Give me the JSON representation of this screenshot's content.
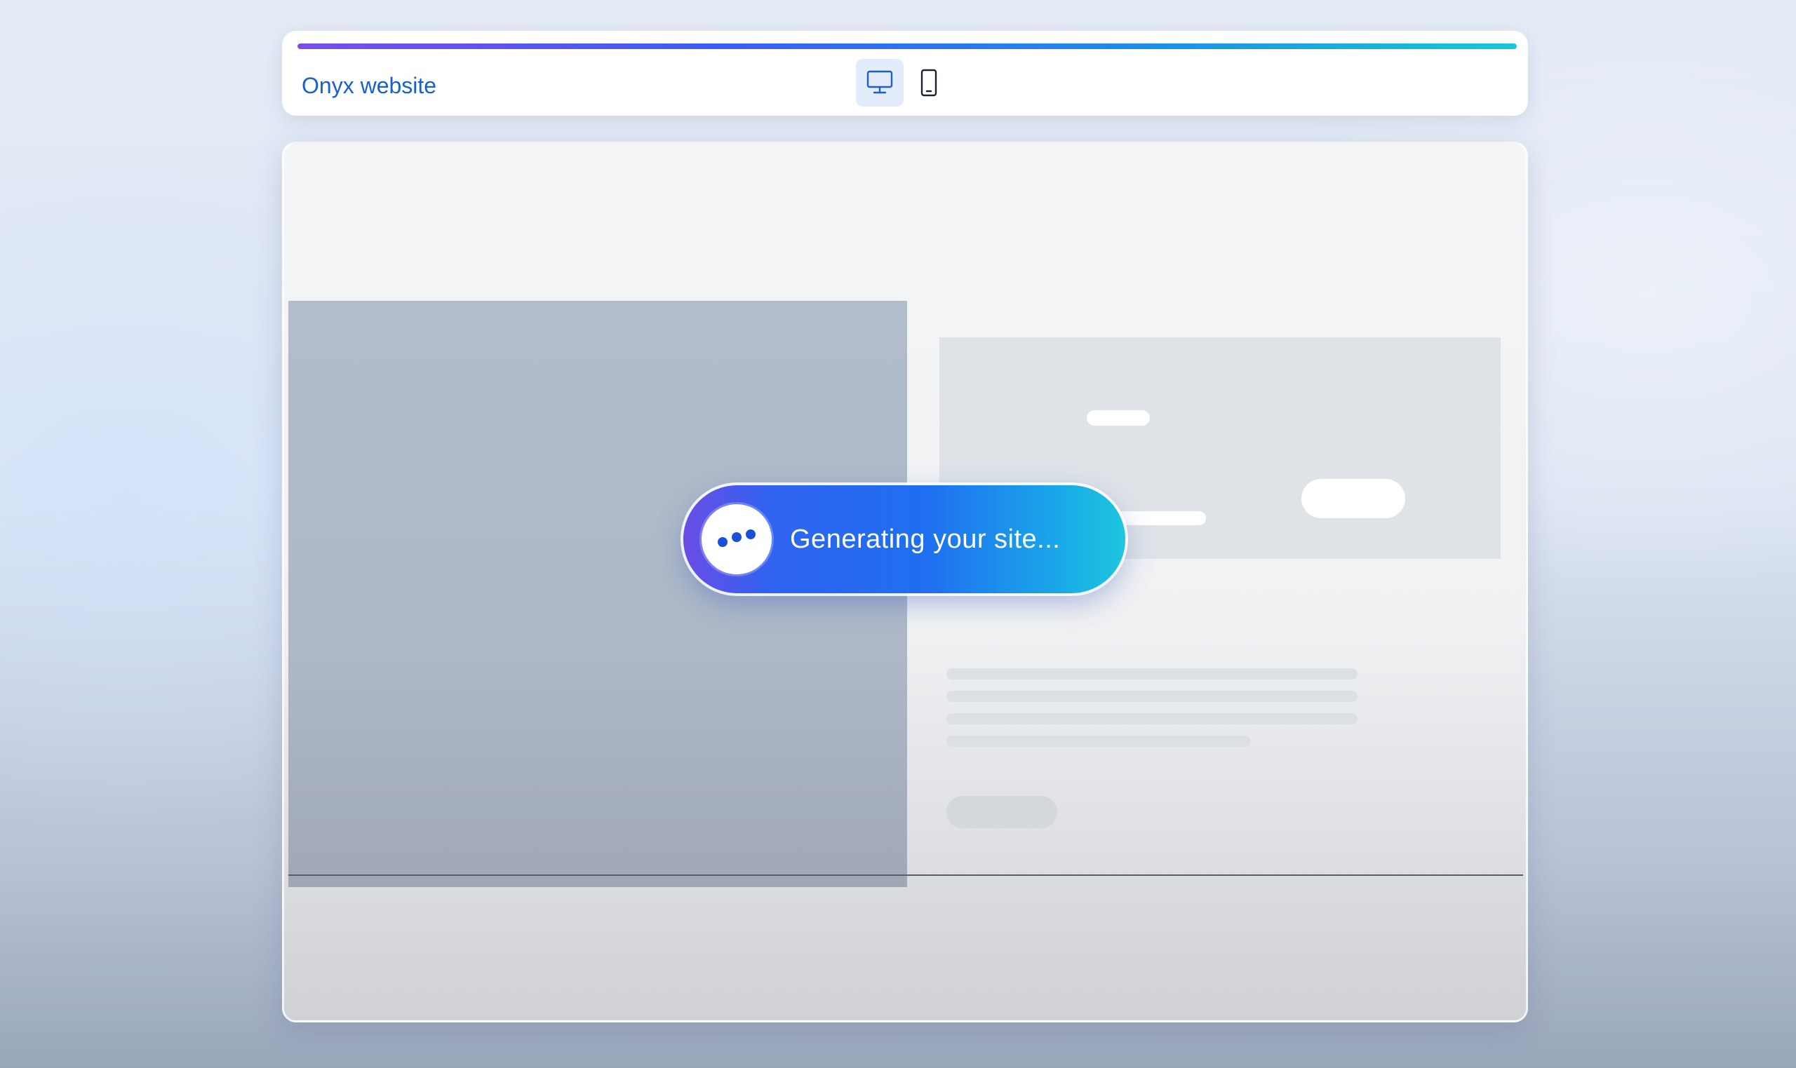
{
  "header": {
    "site_title": "Onyx website",
    "progress_fraction": 1.0
  },
  "device_toggle": {
    "active": "desktop",
    "options": [
      {
        "id": "desktop",
        "icon": "desktop-monitor-icon"
      },
      {
        "id": "mobile",
        "icon": "mobile-phone-icon"
      }
    ]
  },
  "status": {
    "message": "Generating your site...",
    "icon": "typing-dots-icon"
  },
  "colors": {
    "accent": "#1a5fd0",
    "progress_start": "#7b4dea",
    "progress_end": "#18c8d8",
    "pill_start": "#6a4de6",
    "pill_end": "#1ec6df"
  }
}
